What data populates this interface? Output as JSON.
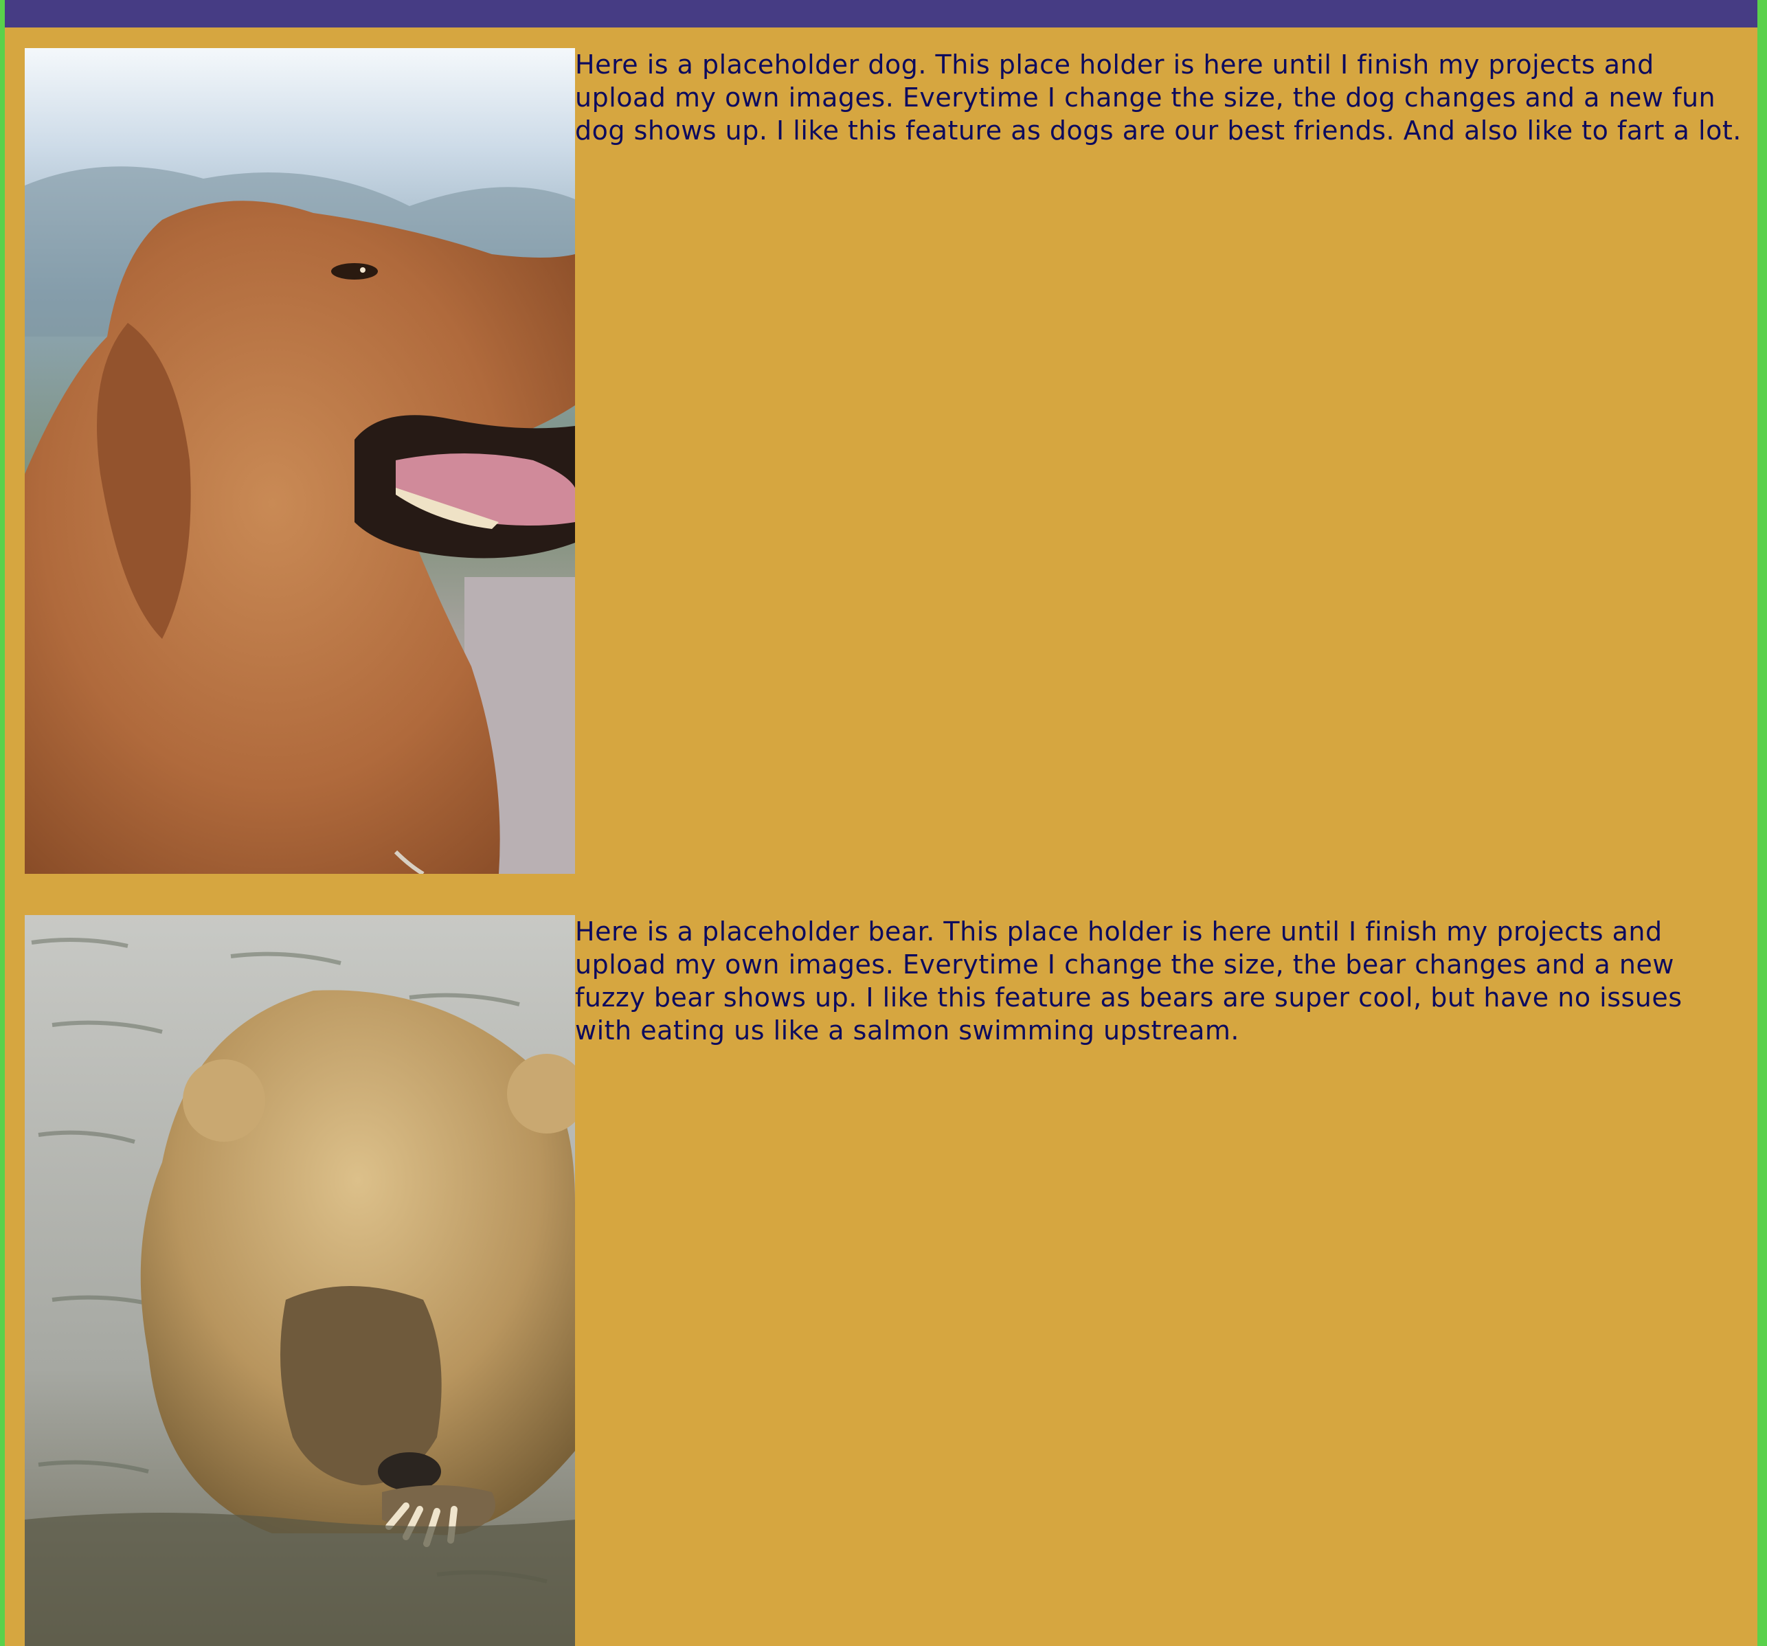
{
  "theme": {
    "page_background": "#d6a640",
    "header_bar": "#463c84",
    "outer_border": "#5ad14b",
    "text_color": "#0d0b5e"
  },
  "sections": [
    {
      "image": "golden-retriever-photo",
      "text": "Here is a placeholder dog. This place holder is here until I finish my projects and upload my own images. Everytime I change the size, the dog changes and a new fun dog shows up. I like this feature as dogs are our best friends. And also like to fart a lot."
    },
    {
      "image": "brown-bear-photo",
      "text": "Here is a placeholder bear. This place holder is here until I finish my projects and upload my own images. Everytime I change the size, the bear changes and a new fuzzy bear shows up. I like this feature as bears are super cool, but have no issues with eating us like a salmon swimming upstream."
    }
  ]
}
